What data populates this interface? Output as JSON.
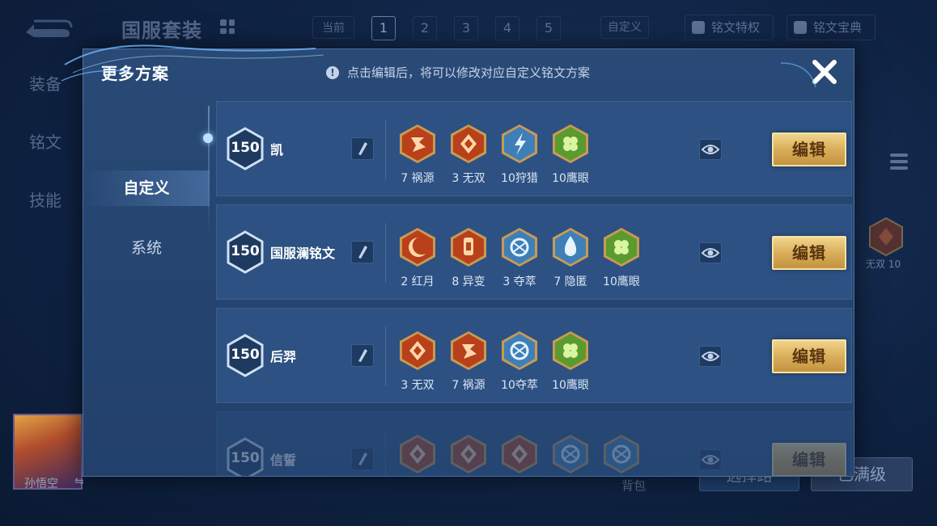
{
  "background": {
    "title": "国服套装",
    "current_label": "当前",
    "pages": [
      "1",
      "2",
      "3",
      "4",
      "5"
    ],
    "custom_label": "自定义",
    "rune_privilege": "铭文特权",
    "rune_guide": "铭文宝典",
    "side_tabs": [
      "装备",
      "铭文",
      "技能"
    ],
    "hero_name": "孙悟空",
    "hero_swap_icon": "⇋",
    "right_rune_label": "无双 10",
    "bag_label": "背包",
    "button1_label": "选择路",
    "button2_label": "已满级"
  },
  "modal": {
    "title": "更多方案",
    "hint_icon": "!",
    "hint": "点击编辑后，将可以修改对应自定义铭文方案",
    "nav": [
      "自定义",
      "系统"
    ],
    "edit_label": "编辑",
    "plans": [
      {
        "level": "150",
        "name": "凯",
        "runes": [
          {
            "label": "7 祸源",
            "color": "red",
            "icon": "rune-red-claw-icon"
          },
          {
            "label": "3 无双",
            "color": "red",
            "icon": "rune-red-diamond-icon"
          },
          {
            "label": "10狩猎",
            "color": "blue",
            "icon": "rune-blue-bolt-icon"
          },
          {
            "label": "10鹰眼",
            "color": "green",
            "icon": "rune-green-clover-icon"
          }
        ]
      },
      {
        "level": "150",
        "name": "国服澜铭文",
        "runes": [
          {
            "label": "2 红月",
            "color": "red",
            "icon": "rune-red-moon-icon"
          },
          {
            "label": "8 异变",
            "color": "red",
            "icon": "rune-red-totem-icon"
          },
          {
            "label": "3 夺萃",
            "color": "blue",
            "icon": "rune-blue-knot-icon"
          },
          {
            "label": "7 隐匿",
            "color": "blue",
            "icon": "rune-blue-drop-icon"
          },
          {
            "label": "10鹰眼",
            "color": "green",
            "icon": "rune-green-clover-icon"
          }
        ]
      },
      {
        "level": "150",
        "name": "后羿",
        "runes": [
          {
            "label": "3 无双",
            "color": "red",
            "icon": "rune-red-diamond-icon"
          },
          {
            "label": "7 祸源",
            "color": "red",
            "icon": "rune-red-claw-icon"
          },
          {
            "label": "10夺萃",
            "color": "blue",
            "icon": "rune-blue-knot-icon"
          },
          {
            "label": "10鹰眼",
            "color": "green",
            "icon": "rune-green-clover-icon"
          }
        ]
      },
      {
        "level": "150",
        "name": "信誓",
        "runes": [
          {
            "label": "",
            "color": "red",
            "icon": "rune-red-icon"
          },
          {
            "label": "",
            "color": "red",
            "icon": "rune-red-icon"
          },
          {
            "label": "",
            "color": "red",
            "icon": "rune-red-icon"
          },
          {
            "label": "",
            "color": "blue",
            "icon": "rune-blue-icon"
          },
          {
            "label": "",
            "color": "blue",
            "icon": "rune-blue-icon"
          }
        ]
      }
    ]
  },
  "colors": {
    "red": "#c8451f",
    "blue": "#5f9fcf",
    "green": "#6fae3a",
    "gold": "#d9ae5a"
  }
}
